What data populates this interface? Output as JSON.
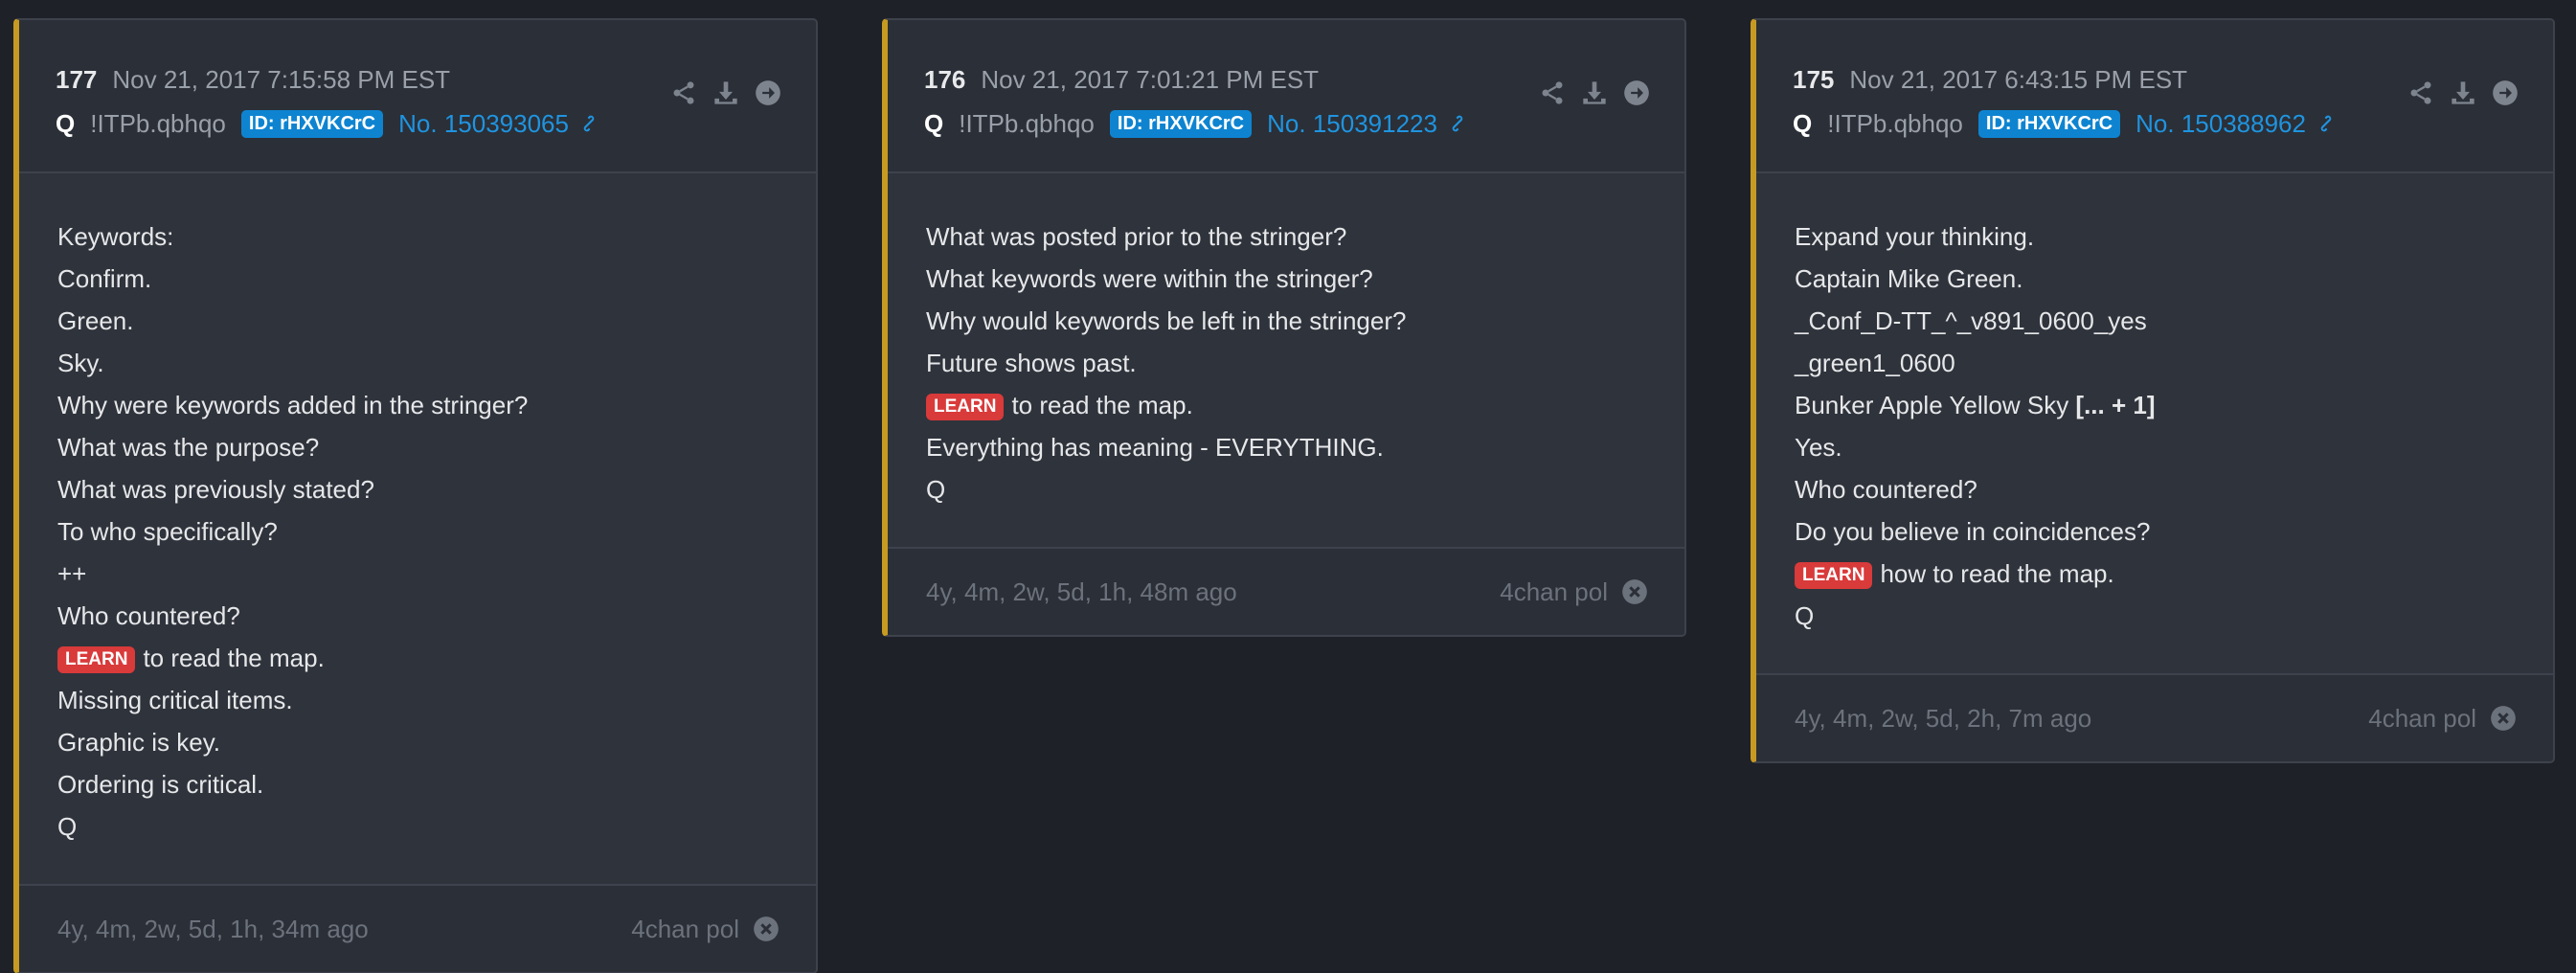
{
  "posts": [
    {
      "number": "177",
      "date": "Nov 21, 2017 7:15:58 PM EST",
      "author": "Q",
      "tripcode": "!ITPb.qbhqo",
      "id_badge": "ID: rHXVKCrC",
      "post_no": "No. 150393065",
      "lines": [
        {
          "text": "Keywords:"
        },
        {
          "text": "Confirm."
        },
        {
          "text": "Green."
        },
        {
          "text": "Sky."
        },
        {
          "text": "Why were keywords added in the stringer?"
        },
        {
          "text": "What was the purpose?"
        },
        {
          "text": "What was previously stated?"
        },
        {
          "text": "To who specifically?"
        },
        {
          "text": "++"
        },
        {
          "text": "Who countered?"
        },
        {
          "badge": "LEARN",
          "text": "to read the map."
        },
        {
          "text": "Missing critical items."
        },
        {
          "text": "Graphic is key."
        },
        {
          "text": "Ordering is critical."
        },
        {
          "text": "Q"
        }
      ],
      "age": "4y, 4m, 2w, 5d, 1h, 34m ago",
      "source": "4chan pol"
    },
    {
      "number": "176",
      "date": "Nov 21, 2017 7:01:21 PM EST",
      "author": "Q",
      "tripcode": "!ITPb.qbhqo",
      "id_badge": "ID: rHXVKCrC",
      "post_no": "No. 150391223",
      "lines": [
        {
          "text": "What was posted prior to the stringer?"
        },
        {
          "text": "What keywords were within the stringer?"
        },
        {
          "text": "Why would keywords be left in the stringer?"
        },
        {
          "text": "Future shows past."
        },
        {
          "badge": "LEARN",
          "text": "to read the map."
        },
        {
          "text": "Everything has meaning - EVERYTHING."
        },
        {
          "text": "Q"
        }
      ],
      "age": "4y, 4m, 2w, 5d, 1h, 48m ago",
      "source": "4chan pol"
    },
    {
      "number": "175",
      "date": "Nov 21, 2017 6:43:15 PM EST",
      "author": "Q",
      "tripcode": "!ITPb.qbhqo",
      "id_badge": "ID: rHXVKCrC",
      "post_no": "No. 150388962",
      "lines": [
        {
          "text": "Expand your thinking."
        },
        {
          "text": "Captain Mike Green."
        },
        {
          "text": "_Conf_D-TT_^_v891_0600_yes"
        },
        {
          "text": "_green1_0600"
        },
        {
          "text": "Bunker Apple Yellow Sky ",
          "bold_suffix": "[... + 1]"
        },
        {
          "text": "Yes."
        },
        {
          "text": "Who countered?"
        },
        {
          "text": "Do you believe in coincidences?"
        },
        {
          "badge": "LEARN",
          "text": "how to read the map."
        },
        {
          "text": "Q"
        }
      ],
      "age": "4y, 4m, 2w, 5d, 2h, 7m ago",
      "source": "4chan pol"
    }
  ],
  "icons": [
    "share-icon",
    "download-icon",
    "arrow-right-circle-icon",
    "link-icon",
    "close-circle-icon"
  ],
  "colors": {
    "background": "#1e2128",
    "card": "#2f333c",
    "accent_bar": "#c79a22",
    "id_badge": "#0e84d1",
    "link": "#1f94e0",
    "learn_badge": "#d93a3a"
  }
}
